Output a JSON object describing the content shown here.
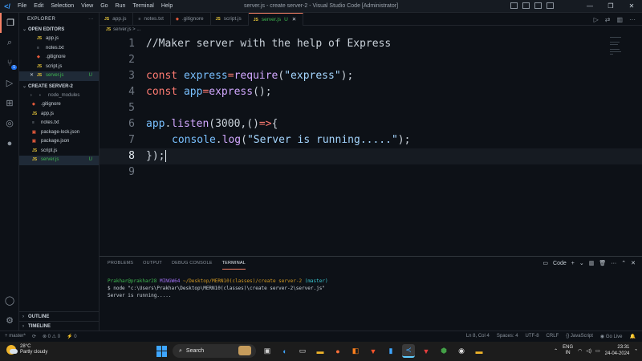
{
  "titlebar": {
    "menu": [
      "File",
      "Edit",
      "Selection",
      "View",
      "Go",
      "Run",
      "Terminal",
      "Help"
    ],
    "window_title": "server.js - create server-2 - Visual Studio Code [Administrator]"
  },
  "activity": {
    "source_control_badge": "1"
  },
  "sidebar": {
    "header": "EXPLORER",
    "open_editors_title": "OPEN EDITORS",
    "open_editors": [
      {
        "name": "app.js",
        "type": "js"
      },
      {
        "name": "notes.txt",
        "type": "txt"
      },
      {
        "name": ".gitignore",
        "type": "git"
      },
      {
        "name": "script.js",
        "type": "js"
      },
      {
        "name": "server.js",
        "type": "js",
        "status": "U"
      }
    ],
    "project_title": "CREATE SERVER-2",
    "files": [
      {
        "name": "node_modules",
        "type": "folder"
      },
      {
        "name": ".gitignore",
        "type": "git"
      },
      {
        "name": "app.js",
        "type": "js"
      },
      {
        "name": "notes.txt",
        "type": "txt"
      },
      {
        "name": "package-lock.json",
        "type": "json"
      },
      {
        "name": "package.json",
        "type": "json"
      },
      {
        "name": "script.js",
        "type": "js"
      },
      {
        "name": "server.js",
        "type": "js",
        "status": "U"
      }
    ],
    "outline": "OUTLINE",
    "timeline": "TIMELINE"
  },
  "tabs": [
    {
      "label": "app.js",
      "type": "js"
    },
    {
      "label": "notes.txt",
      "type": "txt"
    },
    {
      "label": ".gitignore",
      "type": "git"
    },
    {
      "label": "script.js",
      "type": "js"
    },
    {
      "label": "server.js",
      "type": "js",
      "status": "U",
      "active": true
    }
  ],
  "breadcrumb": {
    "file": "server.js",
    "sep": ">",
    "rest": "..."
  },
  "editor": {
    "line_numbers": [
      "1",
      "2",
      "3",
      "4",
      "5",
      "6",
      "7",
      "8",
      "9"
    ],
    "current_line": "8",
    "lines": {
      "l1": "//Maker server with the help of Express",
      "l3_kw": "const",
      "l3_var": "express",
      "l3_op": "=",
      "l3_fn": "require",
      "l3_p1": "(",
      "l3_str": "\"express\"",
      "l3_p2": ");",
      "l4_kw": "const",
      "l4_var": "app",
      "l4_op": "=",
      "l4_fn": "express",
      "l4_p": "();",
      "l6_obj": "app",
      "l6_dot": ".",
      "l6_fn": "listen",
      "l6_p1": "(3000,",
      "l6_arrow_p": "()",
      "l6_arrow": "=>",
      "l6_brace": "{",
      "l7_obj": "console",
      "l7_dot": ".",
      "l7_fn": "log",
      "l7_p1": "(",
      "l7_str": "\"Server is running.....\"",
      "l7_p2": ");",
      "l8_brace": "}",
      "l8_p": ");"
    }
  },
  "panel": {
    "tabs": [
      "PROBLEMS",
      "OUTPUT",
      "DEBUG CONSOLE",
      "TERMINAL"
    ],
    "active_tab": "TERMINAL",
    "shell_label": "Code",
    "terminal": {
      "user": "Prakhar@prakhar28",
      "env": "MINGW64",
      "path": "~/Desktop/MERN10(classes)/create server-2",
      "branch": "(master)",
      "command": "$ node \"c:\\Users\\Prakhar\\Desktop\\MERN10(classes)\\create server-2\\server.js\"",
      "output": "Server is running....."
    }
  },
  "statusbar": {
    "branch": "master*",
    "problems": "⊗ 0 ⚠ 0",
    "ports": "⚡ 0",
    "position": "Ln 8, Col 4",
    "spaces": "Spaces: 4",
    "encoding": "UTF-8",
    "eol": "CRLF",
    "language": "{} JavaScript",
    "golive": "Go Live"
  },
  "taskbar": {
    "temp": "28°C",
    "weather": "Partly cloudy",
    "search_placeholder": "Search",
    "lang1": "ENG",
    "lang2": "IN",
    "time": "23:31",
    "date": "24-04-2024"
  },
  "colors": {
    "accent": "#f78166",
    "js": "#e8c639",
    "git": "#e55a3b",
    "green": "#3fb950"
  }
}
